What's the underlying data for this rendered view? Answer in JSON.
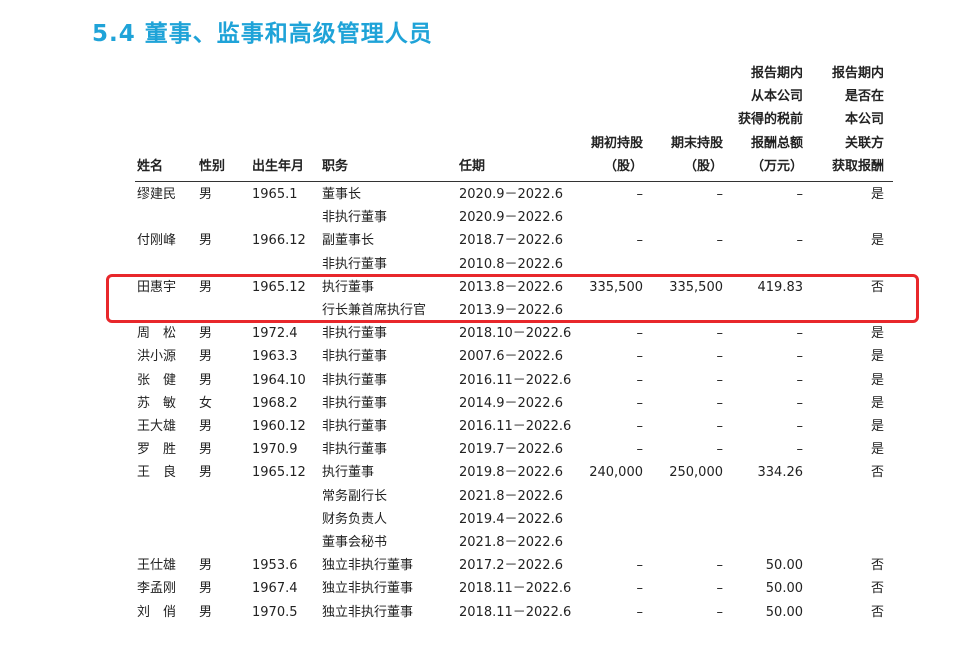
{
  "title": "5.4 董事、监事和高级管理人员",
  "headers": {
    "name": "姓名",
    "gender": "性别",
    "birth": "出生年月",
    "position": "职务",
    "term": "任期",
    "shares_begin": [
      "期初持股",
      "（股）"
    ],
    "shares_end": [
      "期末持股",
      "（股）"
    ],
    "compensation": [
      "报告期内",
      "从本公司",
      "获得的税前",
      "报酬总额",
      "（万元）"
    ],
    "related": [
      "报告期内",
      "是否在",
      "本公司",
      "关联方",
      "获取报酬"
    ]
  },
  "rows": [
    {
      "name": "缪建民",
      "gender": "男",
      "birth": "1965.1",
      "position": "董事长",
      "term": "2020.9－2022.6",
      "begin": "–",
      "end": "–",
      "pay": "–",
      "related": "是"
    },
    {
      "name": "",
      "gender": "",
      "birth": "",
      "position": "非执行董事",
      "term": "2020.9－2022.6",
      "begin": "",
      "end": "",
      "pay": "",
      "related": ""
    },
    {
      "name": "付刚峰",
      "gender": "男",
      "birth": "1966.12",
      "position": "副董事长",
      "term": "2018.7－2022.6",
      "begin": "–",
      "end": "–",
      "pay": "–",
      "related": "是"
    },
    {
      "name": "",
      "gender": "",
      "birth": "",
      "position": "非执行董事",
      "term": "2010.8－2022.6",
      "begin": "",
      "end": "",
      "pay": "",
      "related": ""
    },
    {
      "name": "田惠宇",
      "gender": "男",
      "birth": "1965.12",
      "position": "执行董事",
      "term": "2013.8－2022.6",
      "begin": "335,500",
      "end": "335,500",
      "pay": "419.83",
      "related": "否"
    },
    {
      "name": "",
      "gender": "",
      "birth": "",
      "position": "行长兼首席执行官",
      "term": "2013.9－2022.6",
      "begin": "",
      "end": "",
      "pay": "",
      "related": ""
    },
    {
      "name": "周　松",
      "gender": "男",
      "birth": "1972.4",
      "position": "非执行董事",
      "term": "2018.10－2022.6",
      "begin": "–",
      "end": "–",
      "pay": "–",
      "related": "是"
    },
    {
      "name": "洪小源",
      "gender": "男",
      "birth": "1963.3",
      "position": "非执行董事",
      "term": "2007.6－2022.6",
      "begin": "–",
      "end": "–",
      "pay": "–",
      "related": "是"
    },
    {
      "name": "张　健",
      "gender": "男",
      "birth": "1964.10",
      "position": "非执行董事",
      "term": "2016.11－2022.6",
      "begin": "–",
      "end": "–",
      "pay": "–",
      "related": "是"
    },
    {
      "name": "苏　敏",
      "gender": "女",
      "birth": "1968.2",
      "position": "非执行董事",
      "term": "2014.9－2022.6",
      "begin": "–",
      "end": "–",
      "pay": "–",
      "related": "是"
    },
    {
      "name": "王大雄",
      "gender": "男",
      "birth": "1960.12",
      "position": "非执行董事",
      "term": "2016.11－2022.6",
      "begin": "–",
      "end": "–",
      "pay": "–",
      "related": "是"
    },
    {
      "name": "罗　胜",
      "gender": "男",
      "birth": "1970.9",
      "position": "非执行董事",
      "term": "2019.7－2022.6",
      "begin": "–",
      "end": "–",
      "pay": "–",
      "related": "是"
    },
    {
      "name": "王　良",
      "gender": "男",
      "birth": "1965.12",
      "position": "执行董事",
      "term": "2019.8－2022.6",
      "begin": "240,000",
      "end": "250,000",
      "pay": "334.26",
      "related": "否"
    },
    {
      "name": "",
      "gender": "",
      "birth": "",
      "position": "常务副行长",
      "term": "2021.8－2022.6",
      "begin": "",
      "end": "",
      "pay": "",
      "related": ""
    },
    {
      "name": "",
      "gender": "",
      "birth": "",
      "position": "财务负责人",
      "term": "2019.4－2022.6",
      "begin": "",
      "end": "",
      "pay": "",
      "related": ""
    },
    {
      "name": "",
      "gender": "",
      "birth": "",
      "position": "董事会秘书",
      "term": "2021.8－2022.6",
      "begin": "",
      "end": "",
      "pay": "",
      "related": ""
    },
    {
      "name": "王仕雄",
      "gender": "男",
      "birth": "1953.6",
      "position": "独立非执行董事",
      "term": "2017.2－2022.6",
      "begin": "–",
      "end": "–",
      "pay": "50.00",
      "related": "否"
    },
    {
      "name": "李孟刚",
      "gender": "男",
      "birth": "1967.4",
      "position": "独立非执行董事",
      "term": "2018.11－2022.6",
      "begin": "–",
      "end": "–",
      "pay": "50.00",
      "related": "否"
    },
    {
      "name": "刘　俏",
      "gender": "男",
      "birth": "1970.5",
      "position": "独立非执行董事",
      "term": "2018.11－2022.6",
      "begin": "–",
      "end": "–",
      "pay": "50.00",
      "related": "否"
    }
  ],
  "colors": {
    "title": "#1fa3d8",
    "highlight": "#e8272b"
  }
}
